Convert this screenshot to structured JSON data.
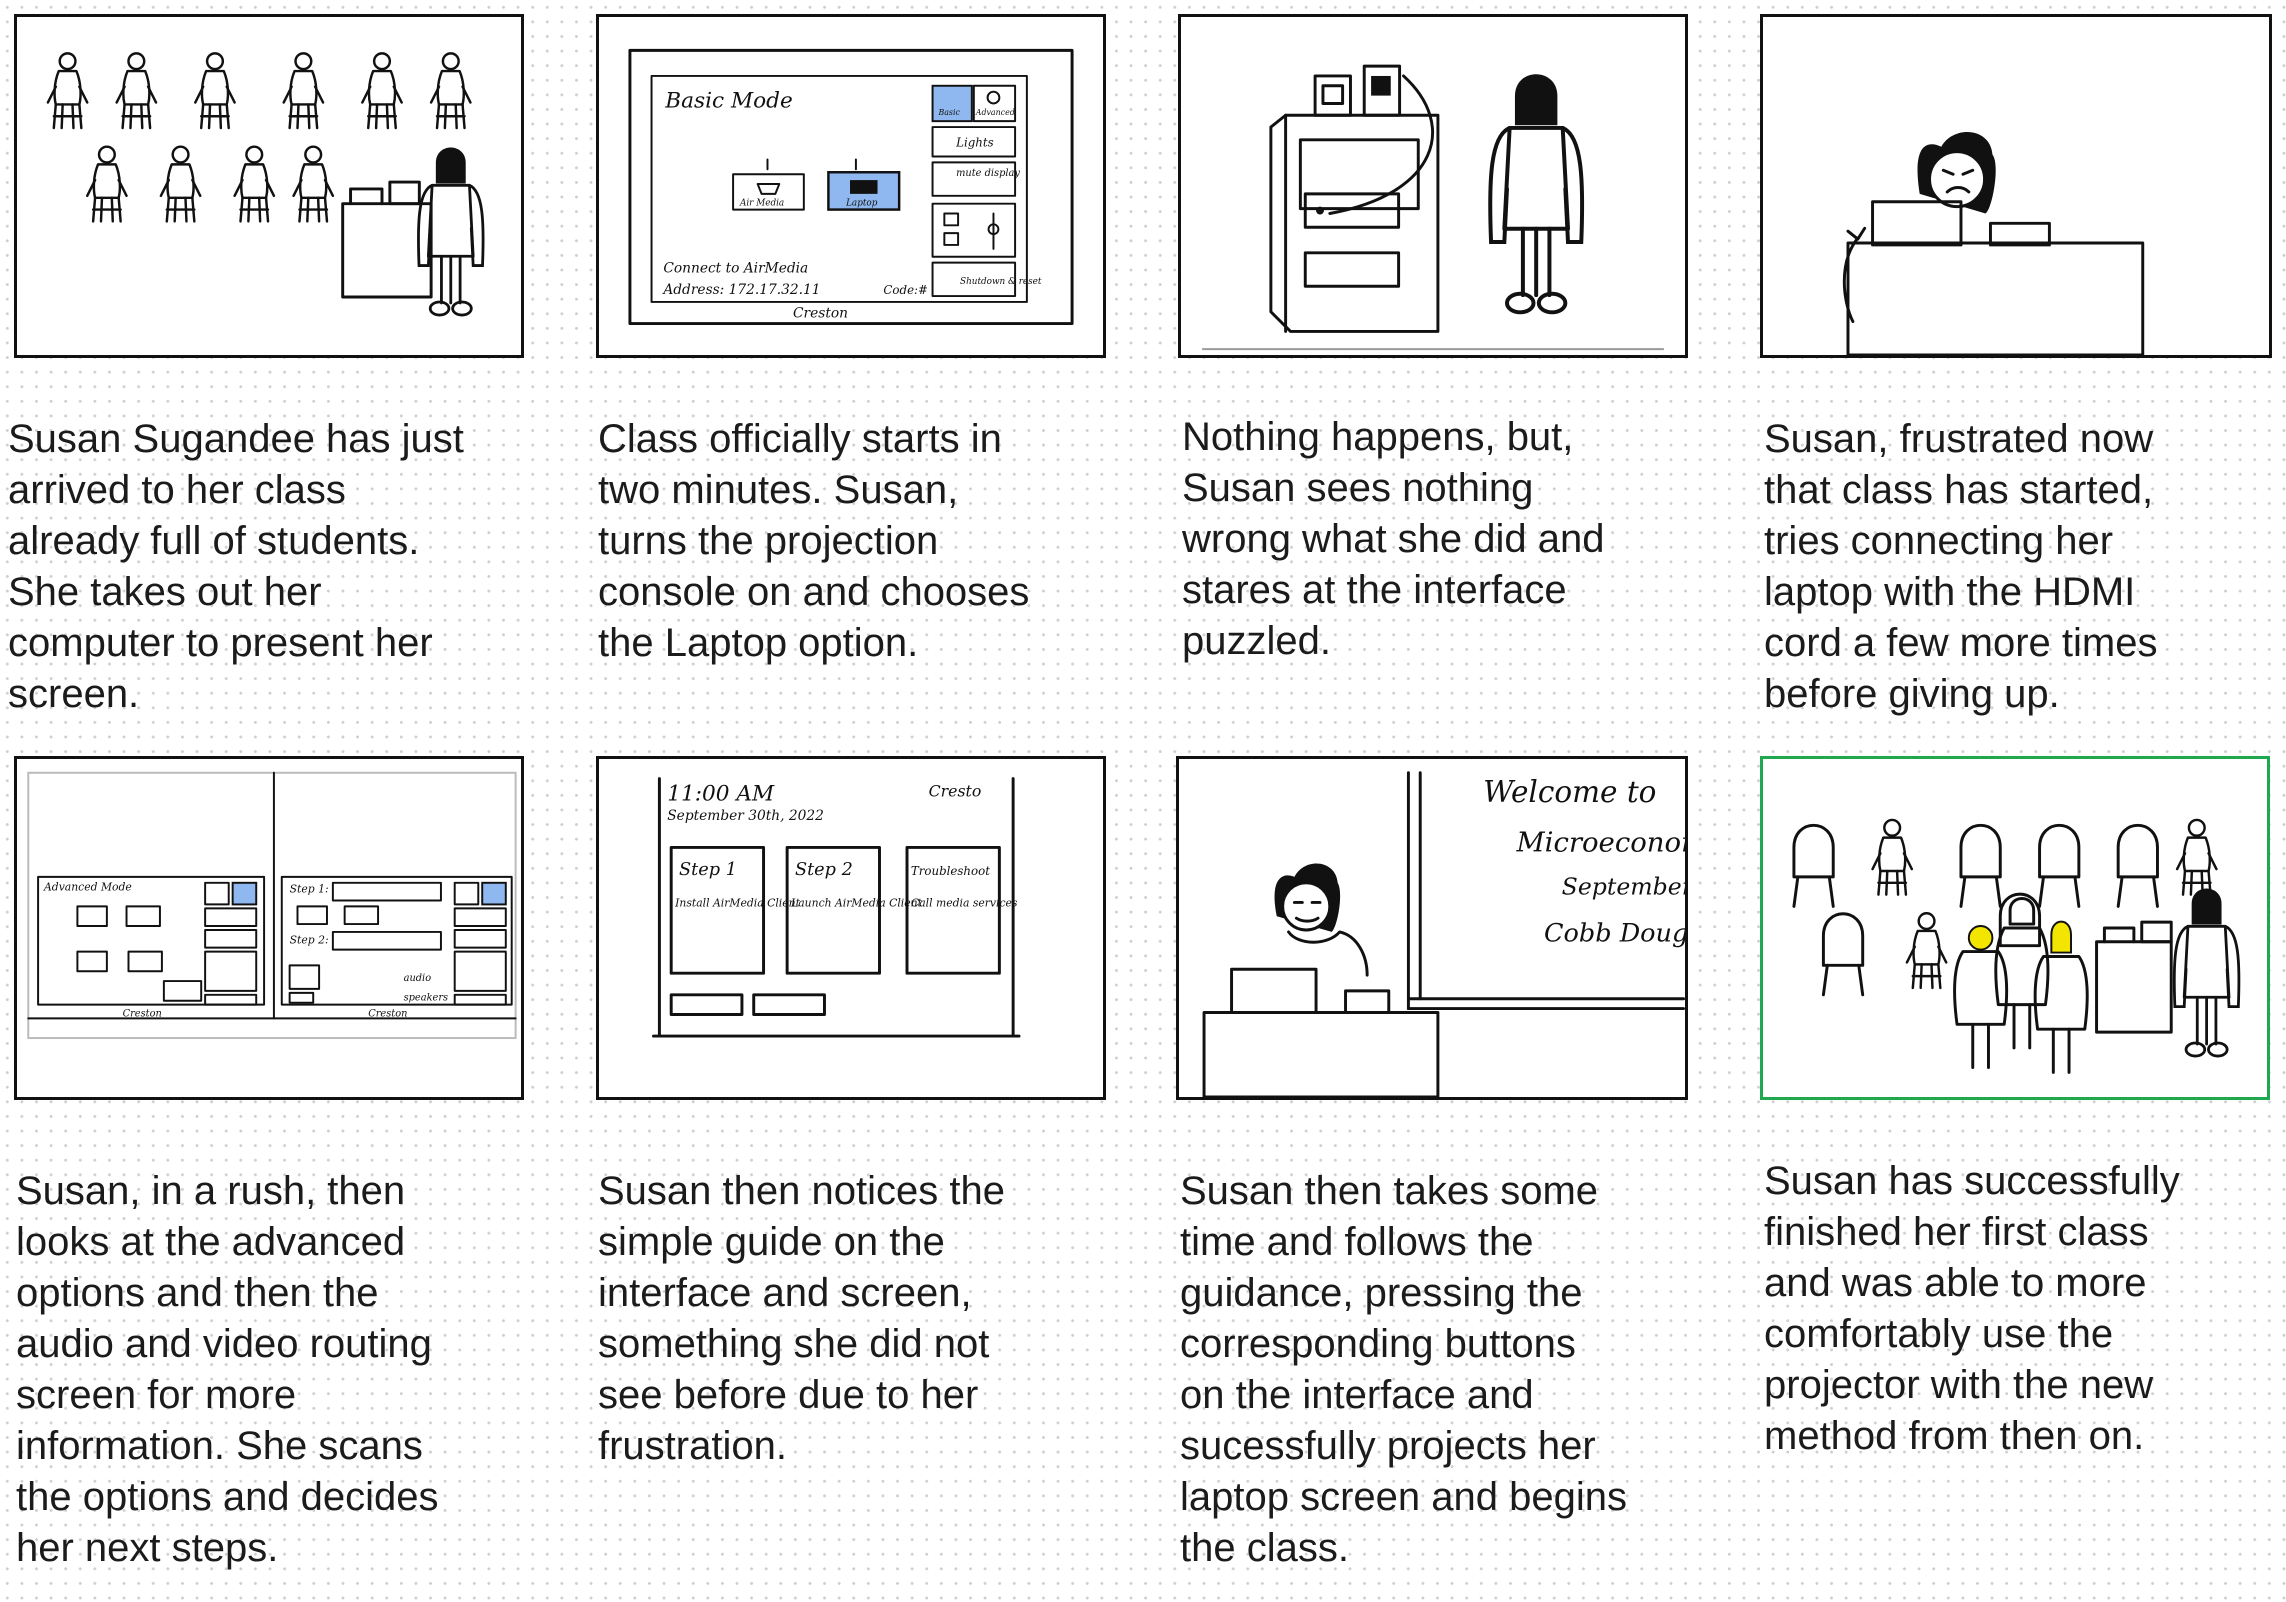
{
  "colors": {
    "highlight_border": "#1fa84f",
    "button_blue": "#8fb8f0",
    "hair_yellow": "#f2e600"
  },
  "panels": [
    {
      "caption": "Susan Sugandee has just\narrived to her class\nalready full of students.\nShe takes out her\ncomputer to present her\nscreen.",
      "sketch": "classroom-arrival"
    },
    {
      "caption": "Class officially starts in\ntwo minutes. Susan,\nturns the projection\nconsole on and chooses\nthe Laptop option.",
      "sketch": "basic-mode-interface",
      "ui": {
        "title": "Basic Mode",
        "airmedia": "Air Media",
        "laptop": "Laptop",
        "basic": "Basic",
        "advanced": "Advanced",
        "lights": "Lights",
        "mute_display": "mute display",
        "shutdown": "Shutdown & reset",
        "connect": "Connect to AirMedia",
        "address": "Address: 172.17.32.11",
        "code": "Code:#",
        "brand": "Creston"
      }
    },
    {
      "caption": "Nothing happens, but,\nSusan sees nothing\nwrong what she did and\nstares at the interface\npuzzled.",
      "sketch": "console-cabinet"
    },
    {
      "caption": "Susan, frustrated now\nthat class has started,\ntries connecting her\nlaptop with the HDMI\ncord a few more times\nbefore giving up.",
      "sketch": "frustrated-at-desk"
    },
    {
      "caption": "Susan, in a rush, then\nlooks at the advanced\noptions and then the\naudio and video routing\nscreen for more\ninformation. She scans\nthe options and decides\nher next steps.",
      "sketch": "advanced-mode-interface",
      "ui": {
        "title": "Advanced Mode",
        "step1": "Step 1:",
        "step2": "Step 2:",
        "audio": "audio",
        "speakers": "speakers",
        "brand_left": "Creston",
        "brand_right": "Creston"
      }
    },
    {
      "caption": "Susan then notices the\nsimple guide on the\ninterface and screen,\nsomething she did not\nsee before due to her\nfrustration.",
      "sketch": "guide-screen",
      "ui": {
        "time": "11:00 AM",
        "date": "September 30th, 2022",
        "brand": "Cresto",
        "step1_title": "Step 1",
        "step1_body": "Install AirMedia Client",
        "step2_title": "Step 2",
        "step2_body": "Launch AirMedia Client",
        "trouble_title": "Troubleshoot",
        "trouble_body": "Call media services"
      }
    },
    {
      "caption": "Susan then takes some\ntime and follows the\nguidance, pressing the\ncorresponding buttons\non the interface and\nsucessfully projects her\nlaptop screen and begins\nthe class.",
      "sketch": "projecting-welcome",
      "ui": {
        "line1": "Welcome to",
        "line2": "Microeconom",
        "line3": "September",
        "line4": "Cobb Dougl"
      }
    },
    {
      "caption": "Susan has successfully\nfinished her first class\nand was able to more\ncomfortably use the\nprojector with the new\nmethod from then on.",
      "sketch": "class-finished",
      "highlighted": true
    }
  ]
}
